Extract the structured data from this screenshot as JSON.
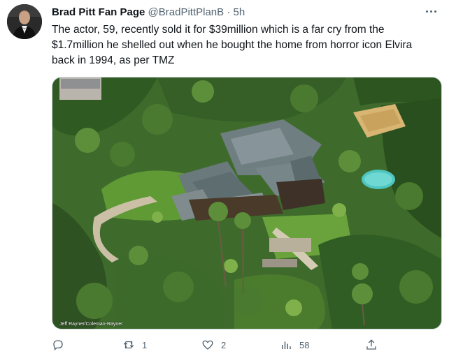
{
  "author": {
    "display_name": "Brad Pitt Fan Page",
    "handle": "@BradPittPlanB",
    "separator": "·",
    "time": "5h"
  },
  "tweet": {
    "text": "The actor, 59, recently sold it for $39million which is a far cry from the $1.7million he shelled out when he bought the home from horror icon Elvira back in 1994, as per TMZ"
  },
  "media": {
    "credit": "Jeff Rayner/Coleman-Rayner"
  },
  "actions": {
    "reply_count": "",
    "retweet_count": "1",
    "like_count": "2",
    "views_count": "58"
  },
  "icons": {
    "reply": "reply-icon",
    "retweet": "retweet-icon",
    "like": "heart-icon",
    "views": "views-icon",
    "share": "share-icon",
    "more": "more-icon"
  },
  "colors": {
    "text": "#0f1419",
    "secondary": "#536471",
    "border": "#cfd9de"
  }
}
